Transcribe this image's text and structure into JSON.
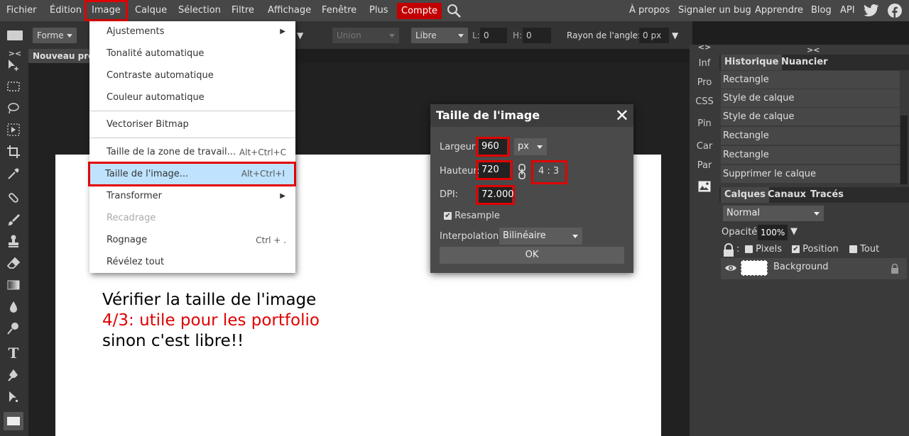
{
  "menubar": {
    "items": [
      "Fichier",
      "Édition",
      "Image",
      "Calque",
      "Sélection",
      "Filtre",
      "Affichage",
      "Fenêtre",
      "Plus",
      "Compte"
    ],
    "right_items": [
      "À propos",
      "Signaler un bug",
      "Apprendre",
      "Blog",
      "API"
    ],
    "accent_color": "#c30000",
    "highlight_color": "#e00000"
  },
  "options": {
    "forme_label": "Forme",
    "union_label": "Union",
    "mode_label": "Libre",
    "l_label": "L:",
    "l_value": "0",
    "h_label": "H:",
    "h_value": "0",
    "rayon_label": "Rayon de l'angle:",
    "rayon_value": "0 px"
  },
  "doc": {
    "tab_title": "Nouveau pro"
  },
  "image_menu": {
    "items": [
      {
        "label": "Ajustements",
        "shortcut": "",
        "submenu": true,
        "disabled": false
      },
      {
        "label": "Tonalité automatique",
        "shortcut": "",
        "submenu": false,
        "disabled": false
      },
      {
        "label": "Contraste automatique",
        "shortcut": "",
        "submenu": false,
        "disabled": false
      },
      {
        "label": "Couleur automatique",
        "shortcut": "",
        "submenu": false,
        "disabled": false
      },
      {
        "label": "Vectoriser Bitmap",
        "shortcut": "",
        "submenu": false,
        "disabled": false
      },
      {
        "label": "Taille de la zone de travail...",
        "shortcut": "Alt+Ctrl+C",
        "submenu": false,
        "disabled": false
      },
      {
        "label": "Taille de l'image...",
        "shortcut": "Alt+Ctrl+I",
        "submenu": false,
        "disabled": false,
        "selected": true
      },
      {
        "label": "Transformer",
        "shortcut": "",
        "submenu": true,
        "disabled": false
      },
      {
        "label": "Recadrage",
        "shortcut": "",
        "submenu": false,
        "disabled": true
      },
      {
        "label": "Rognage",
        "shortcut": "Ctrl + .",
        "submenu": false,
        "disabled": false
      },
      {
        "label": "Révélez tout",
        "shortcut": "",
        "submenu": false,
        "disabled": false
      }
    ]
  },
  "dialog": {
    "title": "Taille de l'image",
    "width_label": "Largeur:",
    "width_value": "960",
    "unit": "px",
    "height_label": "Hauteur:",
    "height_value": "720",
    "ratio": "4 : 3",
    "dpi_label": "DPI:",
    "dpi_value": "72.000",
    "resample_label": "Resample",
    "resample_checked": true,
    "interp_label": "Interpolation:",
    "interp_value": "Bilinéaire",
    "ok_label": "OK"
  },
  "canvas_text": {
    "line1": "Vérifier la taille de l'image",
    "line2": "4/3: utile pour les portfolio",
    "line3": "sinon c'est libre!!",
    "line2_color": "#e00000"
  },
  "mini_panel": {
    "items": [
      "Inf",
      "Pro",
      "CSS",
      "Pin",
      "Car",
      "Par"
    ]
  },
  "history_panel": {
    "tabs": [
      "Historique",
      "Nuancier"
    ],
    "items": [
      "Rectangle",
      "Style de calque",
      "Style de calque",
      "Rectangle",
      "Rectangle",
      "Supprimer le calque"
    ]
  },
  "layers_panel": {
    "tabs": [
      "Calques",
      "Canaux",
      "Tracés"
    ],
    "blend_mode": "Normal",
    "opacity_label": "Opacité:",
    "opacity_value": "100%",
    "lock_pixels": "Pixels",
    "lock_position": "Position",
    "lock_all": "Tout",
    "layer_name": "Background"
  }
}
